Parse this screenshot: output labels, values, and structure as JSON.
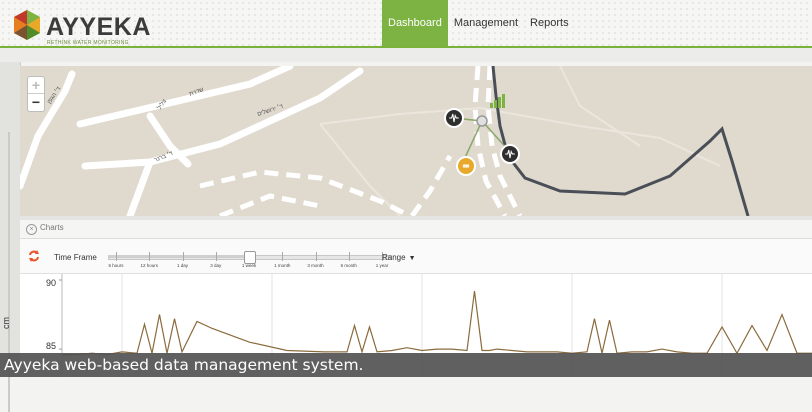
{
  "app": {
    "logo_text": "AYYEKA",
    "logo_tagline": "RETHINK WATER MONITORING",
    "accent_color": "#7cb342"
  },
  "nav": {
    "items": [
      {
        "label": "Dashboard",
        "active": true
      },
      {
        "label": "Management",
        "active": false
      },
      {
        "label": "Reports",
        "active": false
      }
    ]
  },
  "map": {
    "zoom_in": "+",
    "zoom_out": "−",
    "street_labels": [
      "שדרת",
      "ד׳ ירושלים",
      "ד׳ ברנר",
      "ד׳ הגפן",
      "צליל"
    ],
    "markers": [
      {
        "icon": "waveform-icon",
        "color": "#2e2e2e"
      },
      {
        "icon": "waveform-icon",
        "color": "#2e2e2e"
      },
      {
        "icon": "sensor-icon",
        "color": "#e8a92a"
      }
    ]
  },
  "charts": {
    "section_label": "Charts",
    "timeframe_label": "Time Frame",
    "timeframe_options": [
      "6 hours",
      "12 hours",
      "1 day",
      "3 day",
      "1 week",
      "1 month",
      "3 month",
      "6 month",
      "1 year"
    ],
    "timeframe_selected": "1 week",
    "range_label": "Range",
    "y_axis_label": "cm",
    "y_ticks": [
      "90",
      "85"
    ]
  },
  "chart_data": {
    "type": "line",
    "ylabel": "cm",
    "ylim": [
      84.5,
      90
    ],
    "series_color": "#8b6b3d",
    "y_ticks": [
      90,
      85
    ],
    "x": [
      0,
      2,
      4,
      6,
      8,
      10,
      11,
      12,
      13,
      14,
      15,
      16,
      18,
      20,
      25,
      30,
      35,
      38,
      39,
      40,
      41,
      42,
      44,
      46,
      48,
      50,
      52,
      54,
      55,
      56,
      57,
      58,
      60,
      62,
      64,
      66,
      68,
      70,
      71,
      72,
      73,
      74,
      76,
      78,
      80,
      82,
      84,
      86,
      88,
      90,
      92,
      94,
      96,
      98,
      100
    ],
    "y": [
      84.6,
      84.6,
      84.7,
      84.6,
      84.8,
      84.7,
      86.8,
      84.7,
      87.5,
      84.7,
      87.2,
      84.8,
      87.0,
      86.5,
      85.5,
      84.9,
      84.8,
      84.8,
      86.7,
      84.8,
      86.6,
      84.8,
      84.9,
      85.1,
      84.9,
      85.0,
      85.0,
      84.9,
      89.2,
      84.9,
      84.9,
      85.0,
      84.9,
      84.8,
      84.8,
      84.8,
      84.7,
      84.8,
      87.2,
      84.7,
      87.1,
      84.7,
      84.8,
      84.8,
      85.0,
      84.8,
      84.7,
      84.7,
      86.6,
      84.7,
      86.7,
      84.9,
      87.5,
      84.7,
      84.7
    ]
  },
  "caption": "Ayyeka web-based data management system."
}
